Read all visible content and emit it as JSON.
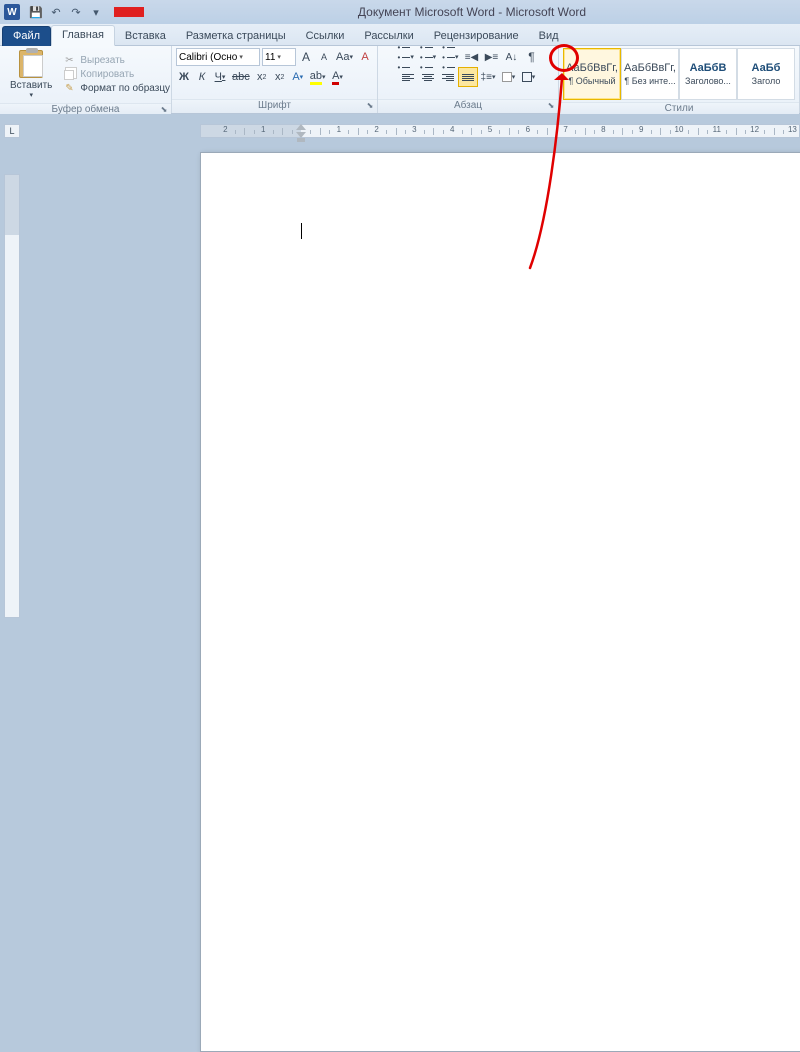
{
  "title": {
    "doc": "Документ Microsoft Word",
    "app": "Microsoft Word"
  },
  "qat": {
    "save": "💾",
    "undo": "↶",
    "redo": "↷",
    "more": "▾"
  },
  "tabs": {
    "file": "Файл",
    "home": "Главная",
    "insert": "Вставка",
    "layout": "Разметка страницы",
    "refs": "Ссылки",
    "mail": "Рассылки",
    "review": "Рецензирование",
    "view": "Вид"
  },
  "clipboard": {
    "paste": "Вставить",
    "cut": "Вырезать",
    "copy": "Копировать",
    "format": "Формат по образцу",
    "group": "Буфер обмена"
  },
  "font": {
    "name": "Calibri (Осно",
    "size": "11",
    "group": "Шрифт",
    "bold": "Ж",
    "italic": "К",
    "underline": "Ч",
    "strike": "abc",
    "sub": "x",
    "sup": "x",
    "case": "Aa",
    "clear": "A",
    "grow": "A",
    "shrink": "A",
    "highlight": "ab",
    "color": "A"
  },
  "para": {
    "group": "Абзац",
    "bullets": "•",
    "numbers": "1",
    "multilist": "≣",
    "dedent": "◀",
    "indent": "▶",
    "sort": "A↓",
    "pilcrow": "¶",
    "spacing": "‡",
    "shade": "⬛",
    "border": "▦"
  },
  "styles": {
    "group": "Стили",
    "items": [
      {
        "preview": "АаБбВвГг,",
        "name": "¶ Обычный",
        "blue": false,
        "sel": true
      },
      {
        "preview": "АаБбВвГг,",
        "name": "¶ Без инте...",
        "blue": false,
        "sel": false
      },
      {
        "preview": "АаБбВ",
        "name": "Заголово...",
        "blue": true,
        "sel": false
      },
      {
        "preview": "АаБб",
        "name": "Заголо",
        "blue": true,
        "sel": false
      }
    ]
  },
  "ruler": {
    "corner": "L"
  }
}
